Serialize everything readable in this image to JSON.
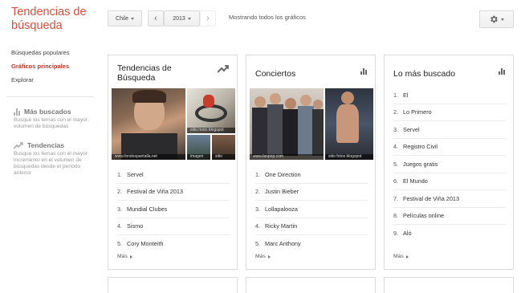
{
  "brand": {
    "title": "Tendencias de búsqueda"
  },
  "nav": {
    "items": [
      {
        "label": "Búsquedas populares",
        "active": false
      },
      {
        "label": "Gráficos principales",
        "active": true
      },
      {
        "label": "Explorar",
        "active": false
      }
    ]
  },
  "sidebar": {
    "sections": [
      {
        "title": "Más buscados",
        "description": "Busque los temas con el mayor volumen de búsquedas",
        "icon": "bar-chart-icon"
      },
      {
        "title": "Tendencias",
        "description": "Busque los temas con el mayor incremento en el volumen de búsquedas desde el período anterior",
        "icon": "trend-icon"
      }
    ]
  },
  "toolbar": {
    "region_label": "Chile",
    "prev_label": "‹",
    "year_label": "2013",
    "next_label": "›",
    "status": "Mostrando todos los gráficos",
    "settings_icon": "gear-icon"
  },
  "cards": [
    {
      "title": "Tendencias de Búsqueda",
      "icon": "trending-up-icon",
      "image_captions": [
        "www.fondospantalla.net",
        "sitio moto blogspot",
        "imagen",
        "sitio"
      ],
      "items": [
        "Servel",
        "Festival de Viña 2013",
        "Mundial Clubes",
        "Sismo",
        "Cory Monteith"
      ],
      "more": "Más"
    },
    {
      "title": "Conciertos",
      "icon": "bar-chart-icon",
      "image_captions": [
        "www.fanpop.com",
        "sitio fotos blogspot"
      ],
      "items": [
        "One Direction",
        "Justin Bieber",
        "Lollapalooza",
        "Ricky Martin",
        "Marc Anthony"
      ],
      "more": "Más"
    },
    {
      "title": "Lo más buscado",
      "icon": "bar-chart-icon",
      "items": [
        "El",
        "Lo Primero",
        "Servel",
        "Registro Civil",
        "Juegos gratis",
        "El Mundo",
        "Festival de Viña 2013",
        "Películas online",
        "Aló"
      ],
      "more": "Más"
    }
  ]
}
